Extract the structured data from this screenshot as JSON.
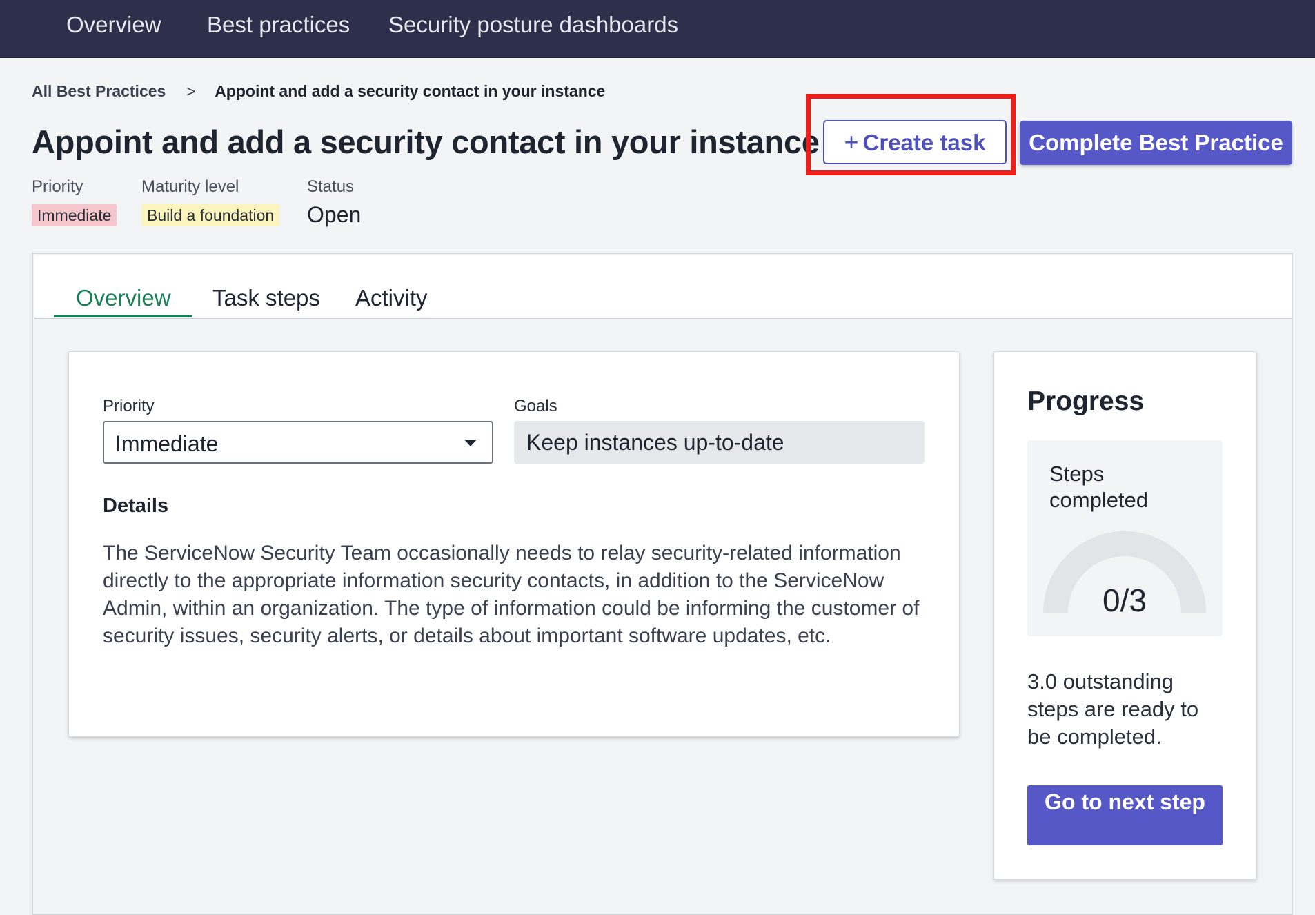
{
  "topnav": {
    "items": [
      {
        "label": "Overview"
      },
      {
        "label": "Best practices"
      },
      {
        "label": "Security posture dashboards"
      }
    ]
  },
  "breadcrumb": {
    "parent": "All Best Practices",
    "separator": ">",
    "current": "Appoint and add a security contact in your instance"
  },
  "page": {
    "title": "Appoint and add a security contact in your instance",
    "create_task_label": "Create task",
    "complete_label": "Complete Best Practice"
  },
  "meta": {
    "priority_label": "Priority",
    "priority_value": "Immediate",
    "maturity_label": "Maturity level",
    "maturity_value": "Build a foundation",
    "status_label": "Status",
    "status_value": "Open"
  },
  "tabs": [
    {
      "label": "Overview",
      "active": true
    },
    {
      "label": "Task steps",
      "active": false
    },
    {
      "label": "Activity",
      "active": false
    }
  ],
  "details_card": {
    "priority_label": "Priority",
    "priority_value": "Immediate",
    "goals_label": "Goals",
    "goals_value": "Keep instances up-to-date",
    "details_heading": "Details",
    "details_text": "The ServiceNow Security Team occasionally needs to relay security-related information directly to the appropriate information security contacts, in addition to the ServiceNow Admin, within an organization. The type of information could be informing the customer of security issues, security alerts, or details about important software updates, etc."
  },
  "progress": {
    "title": "Progress",
    "steps_label": "Steps completed",
    "completed": 0,
    "total": 3,
    "display": "0/3",
    "outstanding_text": "3.0 outstanding steps are ready to be completed.",
    "next_button": "Go to next step"
  },
  "colors": {
    "nav_bg": "#2e2f4a",
    "primary": "#5558c6",
    "active_tab": "#1a7e56",
    "highlight": "#ee1f1a",
    "priority_badge": "#f5c6cb",
    "maturity_badge": "#fbf4bd"
  }
}
